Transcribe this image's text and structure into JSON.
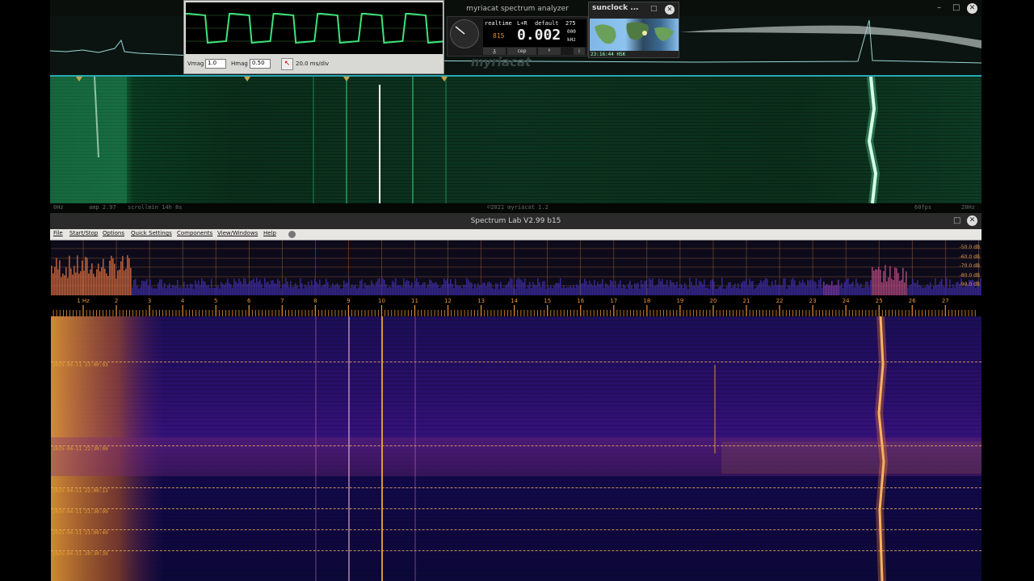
{
  "myriacat": {
    "title": "myriacat spectrum analyzer",
    "status_left": "0Hz",
    "status_amp": "amp 2.97",
    "status_scroll": "scrollmin 14h 8s",
    "status_copyright": "©2021 myriacat 1.2",
    "status_fps": "60fps",
    "status_right": "20Hz",
    "readout_mode": "realtime",
    "readout_channel": "L+R",
    "readout_preset": "default",
    "readout_num": "275",
    "readout_small_left": "815",
    "readout_value": "0.002",
    "readout_unit_top": "000",
    "readout_unit": "kHz",
    "buttons": [
      "ᵹ",
      "cep",
      "ᶲ"
    ],
    "info_icon": "i",
    "logo": "myriacat"
  },
  "scope": {
    "vmag_label": "Vmag",
    "vmag_value": "1.0",
    "hmag_label": "Hmag",
    "hmag_value": "0.50",
    "timebase": "20.0 ms/div"
  },
  "sunclock": {
    "title": "sunclock ...",
    "time": "23:16:44 HSK"
  },
  "spectrum_lab": {
    "title": "Spectrum Lab V2.99 b15",
    "menu": [
      "File",
      "Start/Stop",
      "Options",
      "Quick Settings",
      "Components",
      "View/Windows",
      "Help"
    ],
    "db_labels": [
      "-50.0 dB",
      "-60.0 dB",
      "-70.0 dB",
      "-80.0 dB",
      "-90.0 dB"
    ],
    "freq_labels": [
      "1 Hz",
      "2",
      "3",
      "4",
      "5",
      "6",
      "7",
      "8",
      "9",
      "10",
      "11",
      "12",
      "13",
      "14",
      "15",
      "16",
      "17",
      "18",
      "19",
      "20",
      "21",
      "22",
      "23",
      "24",
      "25",
      "26",
      "27"
    ],
    "timestamps": [
      "2025-04-11 23:00:03",
      "2025-04-11 22:30:09",
      "2025-04-11 22:00:13",
      "2025-04-11 21:30:09",
      "2025-04-11 21:00:49",
      "2025-04-11 20:30:39"
    ]
  },
  "colors": {
    "myriacat_green": "#3fe08a",
    "waterfall_orange": "#f0a030",
    "spectrum_purple": "#3a1580"
  }
}
